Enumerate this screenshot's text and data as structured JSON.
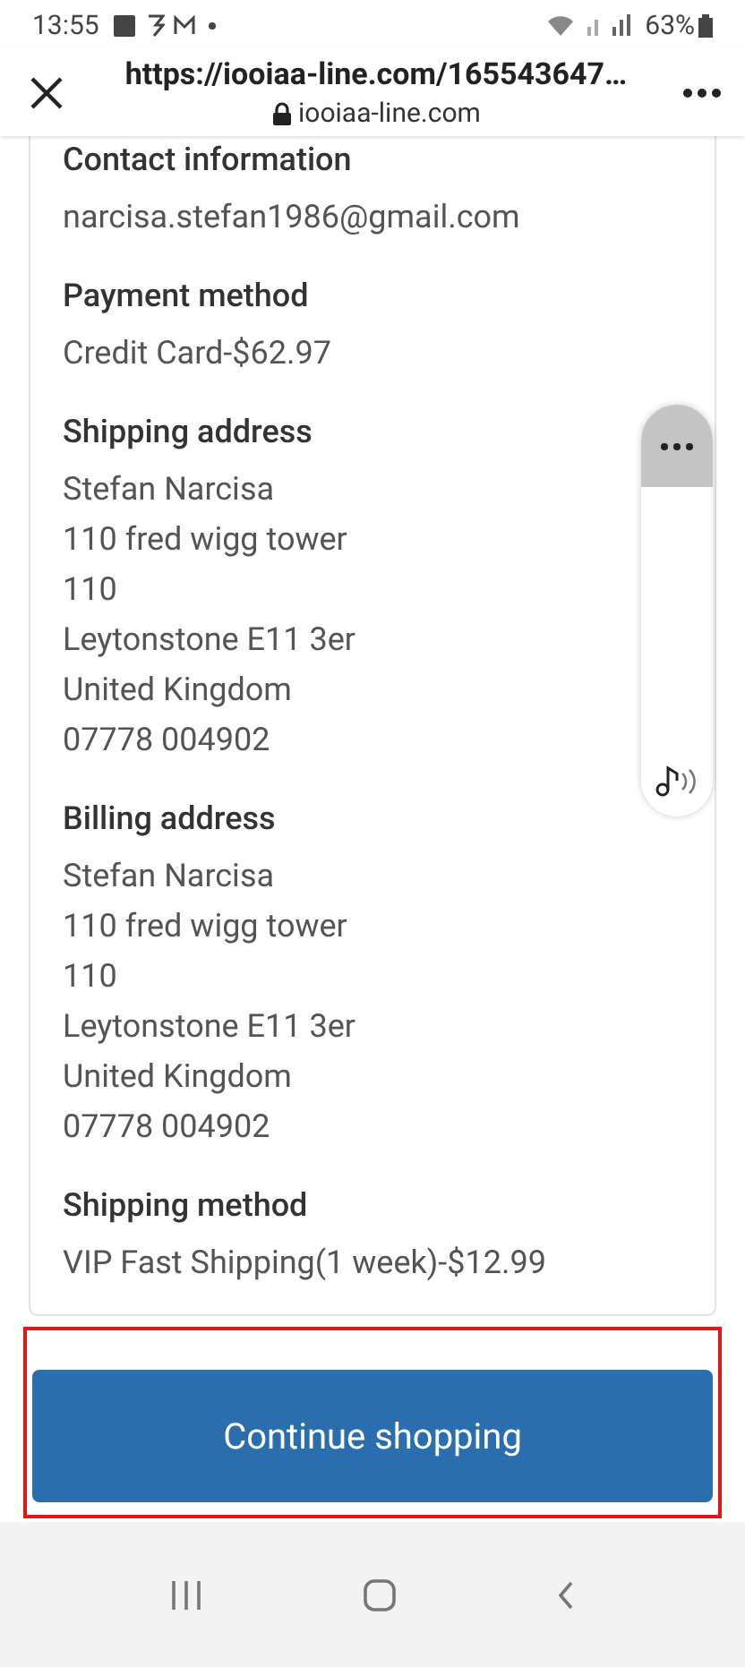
{
  "status_bar": {
    "time": "13:55",
    "battery": "63%"
  },
  "browser_bar": {
    "url": "https://iooiaa-line.com/165543647…",
    "domain": "iooiaa-line.com"
  },
  "sections": [
    {
      "heading": "Contact information",
      "lines": [
        "narcisa.stefan1986@gmail.com"
      ]
    },
    {
      "heading": "Payment method",
      "lines": [
        "Credit Card-$62.97"
      ]
    },
    {
      "heading": "Shipping address",
      "lines": [
        "Stefan Narcisa",
        "110 fred wigg tower",
        "110",
        "Leytonstone E11 3er",
        "United Kingdom",
        "07778 004902"
      ]
    },
    {
      "heading": "Billing address",
      "lines": [
        "Stefan Narcisa",
        "110 fred wigg tower",
        "110",
        "Leytonstone E11 3er",
        "United Kingdom",
        "07778 004902"
      ]
    },
    {
      "heading": "Shipping method",
      "lines": [
        "VIP Fast Shipping(1 week)-$12.99"
      ]
    }
  ],
  "primary_button": {
    "label": "Continue shopping",
    "highlighted": true
  }
}
